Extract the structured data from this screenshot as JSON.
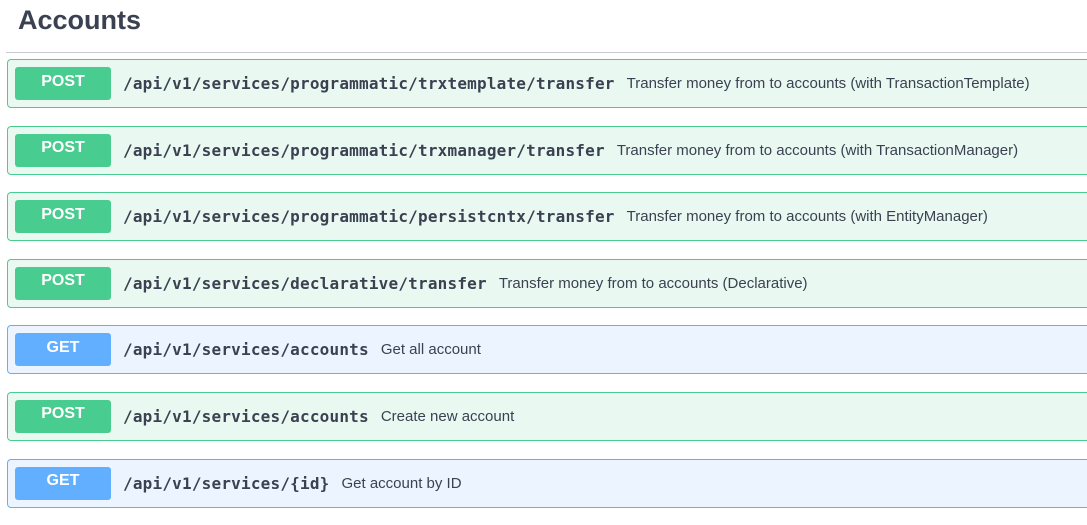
{
  "section": {
    "title": "Accounts"
  },
  "operations": [
    {
      "method": "POST",
      "path": "/api/v1/services/programmatic/trxtemplate/transfer",
      "summary": "Transfer money from to accounts (with TransactionTemplate)"
    },
    {
      "method": "POST",
      "path": "/api/v1/services/programmatic/trxmanager/transfer",
      "summary": "Transfer money from to accounts (with TransactionManager)"
    },
    {
      "method": "POST",
      "path": "/api/v1/services/programmatic/persistcntx/transfer",
      "summary": "Transfer money from to accounts (with EntityManager)"
    },
    {
      "method": "POST",
      "path": "/api/v1/services/declarative/transfer",
      "summary": "Transfer money from to accounts (Declarative)"
    },
    {
      "method": "GET",
      "path": "/api/v1/services/accounts",
      "summary": "Get all account"
    },
    {
      "method": "POST",
      "path": "/api/v1/services/accounts",
      "summary": "Create new account"
    },
    {
      "method": "GET",
      "path": "/api/v1/services/{id}",
      "summary": "Get account by ID"
    }
  ],
  "colors": {
    "post": "#49cc90",
    "get": "#61affe",
    "text": "#3b4151"
  }
}
